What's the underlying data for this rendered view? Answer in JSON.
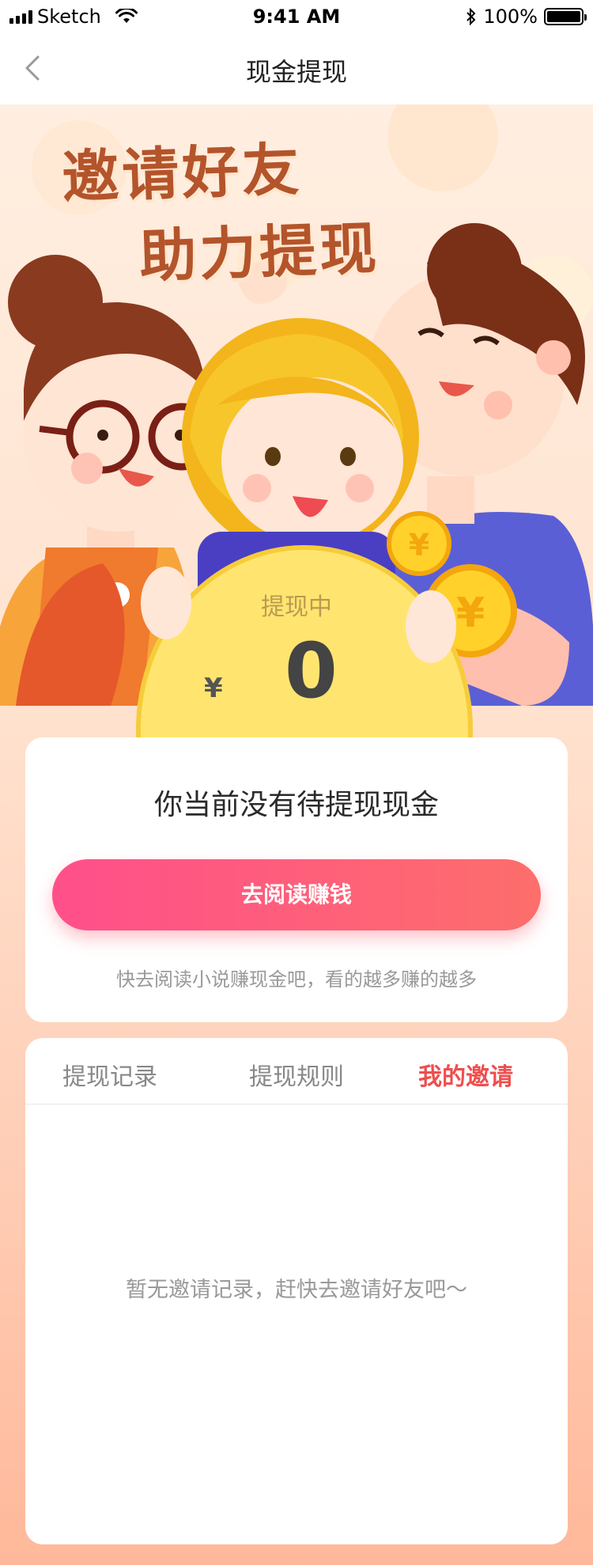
{
  "status_bar": {
    "carrier": "Sketch",
    "time": "9:41 AM",
    "battery": "100%"
  },
  "nav": {
    "title": "现金提现"
  },
  "hero": {
    "headline_line1": "邀请好友",
    "headline_line2": "助力提现",
    "coin_label": "提现中",
    "currency": "¥",
    "amount": "0"
  },
  "summary_card": {
    "message": "你当前没有待提现现金",
    "button_label": "去阅读赚钱",
    "hint": "快去阅读小说赚现金吧，看的越多赚的越多"
  },
  "tabs": [
    {
      "label": "提现记录"
    },
    {
      "label": "提现规则"
    },
    {
      "label": "我的邀请"
    }
  ],
  "active_tab": "我的邀请",
  "empty_state": "暂无邀请记录，赶快去邀请好友吧～",
  "colors": {
    "accent": "#ef4e4e",
    "button_start": "#ff4f8b",
    "button_end": "#fd6e6b",
    "hero_text": "#b4542b"
  }
}
